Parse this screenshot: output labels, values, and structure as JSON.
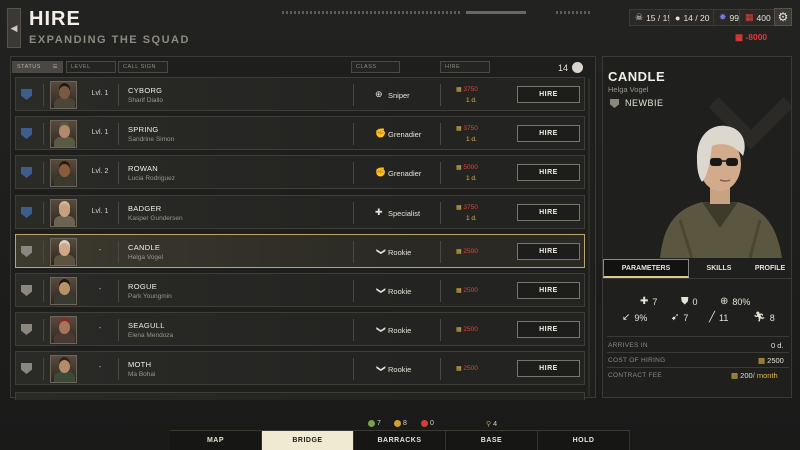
{
  "header": {
    "title": "HIRE",
    "subtitle": "EXPANDING THE SQUAD",
    "back_icon": "chevron-left-icon"
  },
  "resources": {
    "soldiers": "15 / 15",
    "personnel": "14 / 20",
    "intel": "99",
    "supplies": "400",
    "money": "-8000"
  },
  "filters": {
    "status": "STATUS",
    "level": "LEVEL",
    "call_sign": "CALL SIGN",
    "class": "CLASS",
    "hire": "HIRE"
  },
  "recruit_count": "14",
  "recruits": [
    {
      "level": "Lvl. 1",
      "callsign": "CYBORG",
      "name": "Sharif Diallo",
      "class": "Sniper",
      "class_icon": "crosshair-icon",
      "cost": "3750",
      "days": "1 d.",
      "hire": "HIRE",
      "skin": "#7a5a40",
      "hair": "#1e1a16",
      "cloth": "#4a4638",
      "rank": "veteran"
    },
    {
      "level": "Lvl. 1",
      "callsign": "SPRING",
      "name": "Sandrine Simon",
      "class": "Grenadier",
      "class_icon": "grenade-icon",
      "cost": "3750",
      "days": "1 d.",
      "hire": "HIRE",
      "skin": "#b08a6a",
      "hair": "#5c5a3c",
      "cloth": "#5a5a44",
      "rank": "veteran"
    },
    {
      "level": "Lvl. 2",
      "callsign": "ROWAN",
      "name": "Lucia Rodriguez",
      "class": "Grenadier",
      "class_icon": "grenade-icon",
      "cost": "5000",
      "days": "1 d.",
      "hire": "HIRE",
      "skin": "#8a5c3e",
      "hair": "#241a14",
      "cloth": "#3c3a30",
      "rank": "veteran"
    },
    {
      "level": "Lvl. 1",
      "callsign": "BADGER",
      "name": "Kasper Gundersen",
      "class": "Specialist",
      "class_icon": "cross-icon",
      "cost": "3750",
      "days": "1 d.",
      "hire": "HIRE",
      "skin": "#c8a080",
      "hair": "#c9b89a",
      "cloth": "#6a6450",
      "rank": "veteran"
    },
    {
      "level": "-",
      "callsign": "CANDLE",
      "name": "Helga Vogel",
      "class": "Rookie",
      "class_icon": "chevron-down-icon",
      "cost": "2500",
      "days": "",
      "hire": "HIRE",
      "skin": "#d0a888",
      "hair": "#d8d4cc",
      "cloth": "#5a5440",
      "rank": "newbie"
    },
    {
      "level": "-",
      "callsign": "ROGUE",
      "name": "Park Youngmin",
      "class": "Rookie",
      "class_icon": "chevron-down-icon",
      "cost": "2500",
      "days": "",
      "hire": "HIRE",
      "skin": "#b8906a",
      "hair": "#1a1612",
      "cloth": "#3a3a34",
      "rank": "newbie"
    },
    {
      "level": "-",
      "callsign": "SEAGULL",
      "name": "Elena Mendoza",
      "class": "Rookie",
      "class_icon": "chevron-down-icon",
      "cost": "2500",
      "days": "",
      "hire": "HIRE",
      "skin": "#a8745a",
      "hair": "#8a2a22",
      "cloth": "#4a3a34",
      "rank": "newbie"
    },
    {
      "level": "-",
      "callsign": "MOTH",
      "name": "Ma Bohai",
      "class": "Rookie",
      "class_icon": "chevron-down-icon",
      "cost": "2500",
      "days": "",
      "hire": "HIRE",
      "skin": "#b48c6c",
      "hair": "#2a2420",
      "cloth": "#3e4a38",
      "rank": "newbie"
    }
  ],
  "selected": {
    "callsign": "CANDLE",
    "name": "Helga Vogel",
    "rank": "NEWBIE",
    "tabs": [
      "PARAMETERS",
      "SKILLS",
      "PROFILE"
    ],
    "stats": [
      {
        "icon": "health-cross-icon",
        "value": "7"
      },
      {
        "icon": "armor-icon",
        "value": "0"
      },
      {
        "icon": "aim-icon",
        "value": "80%"
      },
      {
        "icon": "crit-icon",
        "value": "9%"
      },
      {
        "icon": "speed-icon",
        "value": "7"
      },
      {
        "icon": "melee-icon",
        "value": "11"
      },
      {
        "icon": "running-icon",
        "value": "8"
      }
    ],
    "arrives_label": "ARRIVES IN",
    "arrives_value": "0 d.",
    "cost_label": "COST OF HIRING",
    "cost_value": "2500",
    "fee_label": "CONTRACT FEE",
    "fee_value": "200",
    "fee_unit": "/ month"
  },
  "bottom": {
    "chips": [
      {
        "value": "7",
        "color": "#7aa04a"
      },
      {
        "value": "8",
        "color": "#d0a030"
      },
      {
        "value": "0",
        "color": "#d0403a"
      },
      {
        "value": "4",
        "color": "#b09a6a"
      }
    ],
    "nav": [
      "MAP",
      "BRIDGE",
      "BARRACKS",
      "BASE",
      "HOLD"
    ],
    "active": "BRIDGE"
  },
  "colors": {
    "accent_gold": "#e0b84a",
    "cost_red": "#d8483c",
    "selected_border": "#b8a670",
    "nav_active": "#f1ead3"
  }
}
